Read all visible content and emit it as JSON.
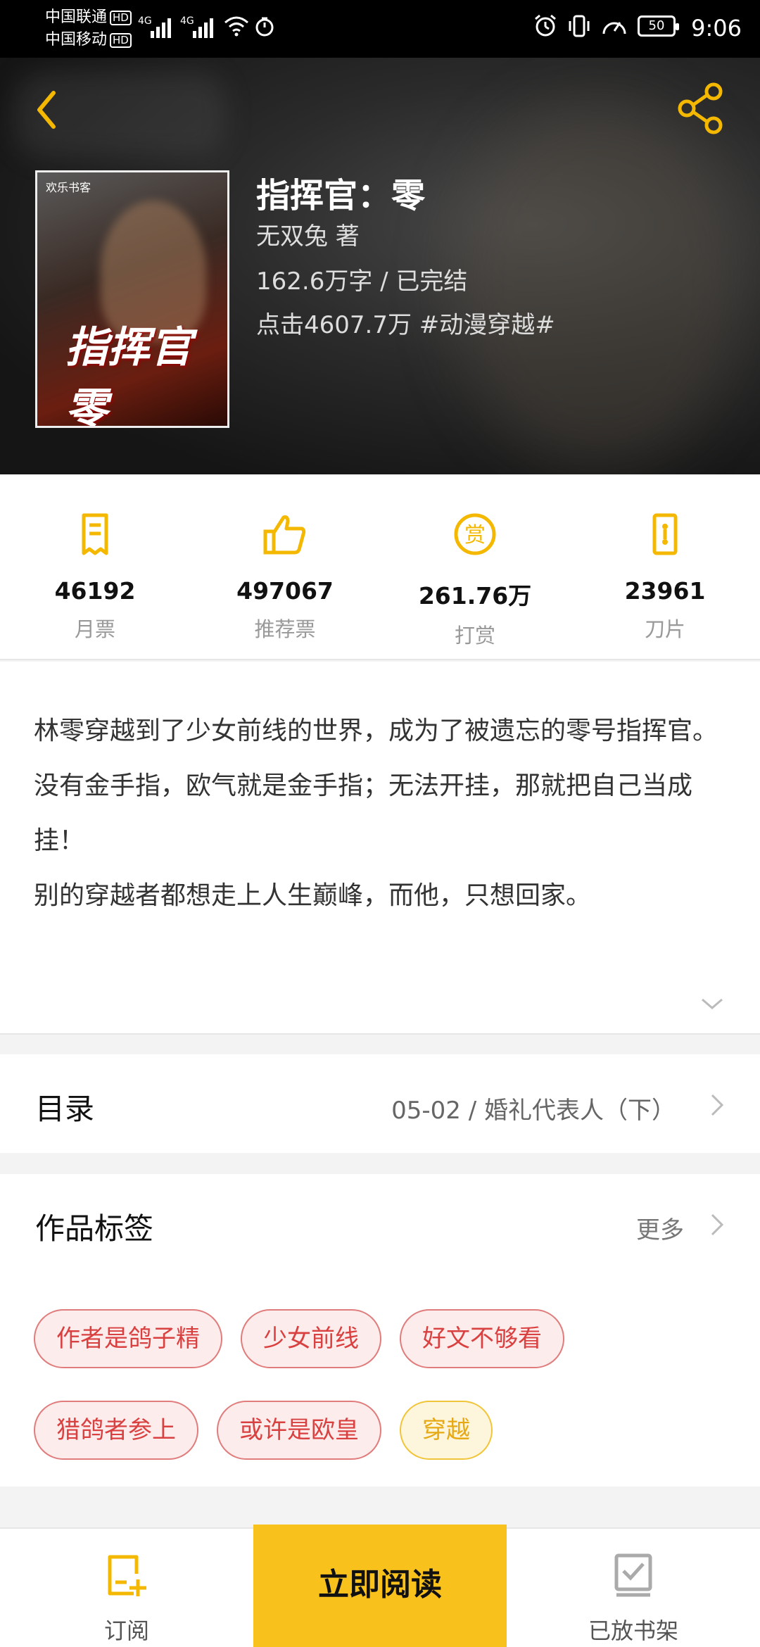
{
  "status_bar": {
    "carrier1": "中国联通",
    "carrier2": "中国移动",
    "hd": "HD",
    "net": "4G",
    "battery": "50",
    "time": "9:06"
  },
  "book": {
    "title": "指挥官：零",
    "author_line": "无双兔  著",
    "words_status": "162.6万字 / 已完结",
    "clicks_genre": "点击4607.7万  #动漫穿越#",
    "cover_title": "指挥官零",
    "cover_brand": "欢乐书客"
  },
  "stats": [
    {
      "value": "46192",
      "label": "月票",
      "icon": "ticket-icon"
    },
    {
      "value": "497067",
      "label": "推荐票",
      "icon": "thumbs-up-icon"
    },
    {
      "value": "261.76万",
      "label": "打赏",
      "icon": "reward-icon"
    },
    {
      "value": "23961",
      "label": "刀片",
      "icon": "blade-icon"
    }
  ],
  "synopsis": {
    "line1": "林零穿越到了少女前线的世界，成为了被遗忘的零号指挥官。",
    "line2": "没有金手指，欧气就是金手指；无法开挂，那就把自己当成挂！",
    "line3": "别的穿越者都想走上人生巅峰，而他，只想回家。"
  },
  "toc": {
    "title": "目录",
    "latest": "05-02 / 婚礼代表人（下）"
  },
  "tags": {
    "title": "作品标签",
    "more": "更多",
    "items": [
      "作者是鸽子精",
      "少女前线",
      "好文不够看",
      "猎鸽者参上",
      "或许是欧皇",
      "穿越"
    ]
  },
  "bottom": {
    "subscribe": "订阅",
    "read_now": "立即阅读",
    "shelf": "已放书架"
  },
  "colors": {
    "accent": "#f8c11c",
    "icon_yellow": "#f5b800",
    "tag_red": "#d94040",
    "tag_yellow": "#e6a914"
  }
}
